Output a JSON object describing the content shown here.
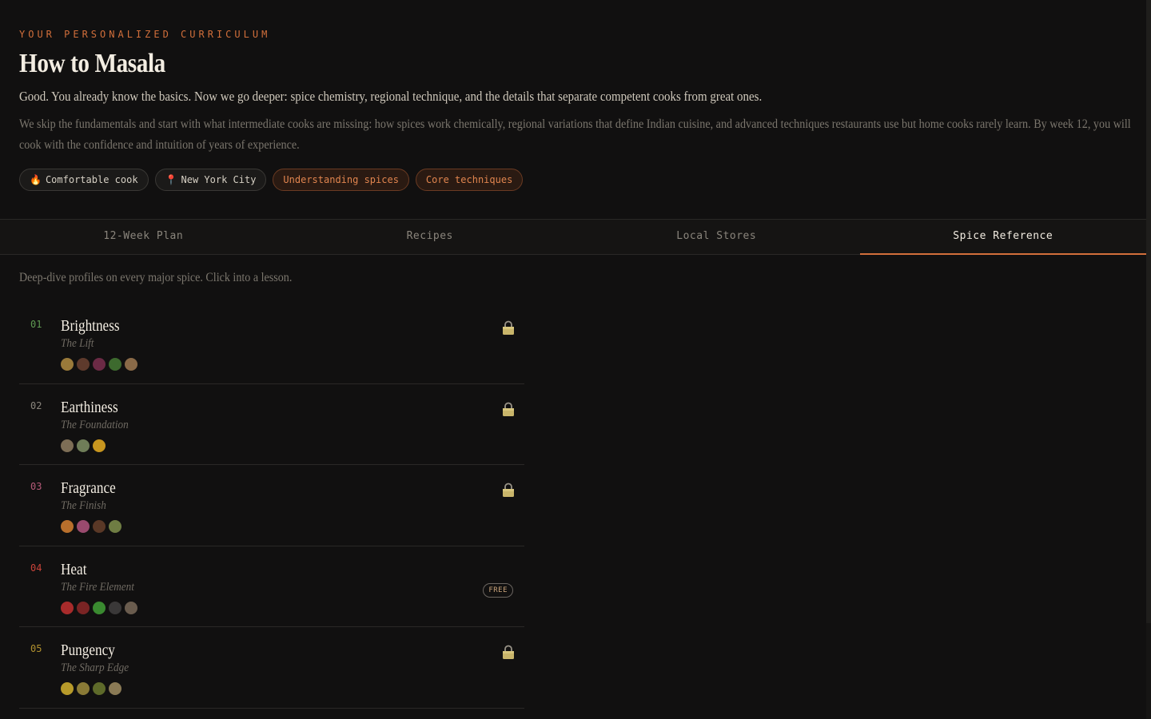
{
  "header": {
    "eyebrow": "YOUR PERSONALIZED CURRICULUM",
    "title": "How to Masala",
    "lede": "Good. You already know the basics. Now we go deeper: spice chemistry, regional technique, and the details that separate competent cooks from great ones.",
    "description": "We skip the fundamentals and start with what intermediate cooks are missing: how spices work chemically, regional variations that define Indian cuisine, and advanced techniques restaurants use but home cooks rarely learn. By week 12, you will cook with the confidence and intuition of years of experience.",
    "chips": [
      {
        "icon": "🔥",
        "icon_name": "fire-icon",
        "label": "Comfortable cook",
        "accent": false
      },
      {
        "icon": "📍",
        "icon_name": "pin-icon",
        "label": "New York City",
        "accent": false
      },
      {
        "icon": "",
        "label": "Understanding spices",
        "accent": true
      },
      {
        "icon": "",
        "label": "Core techniques",
        "accent": true
      }
    ]
  },
  "tabs": [
    {
      "label": "12-Week Plan",
      "active": false
    },
    {
      "label": "Recipes",
      "active": false
    },
    {
      "label": "Local Stores",
      "active": false
    },
    {
      "label": "Spice Reference",
      "active": true
    }
  ],
  "intro": "Deep-dive profiles on every major spice. Click into a lesson.",
  "colors": {
    "accent": "#d26f3b",
    "background": "#111010"
  },
  "lessons": [
    {
      "number": "01",
      "number_color": "#5f9a52",
      "title": "Brightness",
      "subtitle": "The Lift",
      "status": "locked",
      "swatches": [
        "#9a7a3a",
        "#5e3a2c",
        "#6b2a45",
        "#3d6a2e",
        "#8a6a48"
      ]
    },
    {
      "number": "02",
      "number_color": "#8a857c",
      "title": "Earthiness",
      "subtitle": "The Foundation",
      "status": "locked",
      "swatches": [
        "#7d6e56",
        "#6f7d58",
        "#c8961f"
      ]
    },
    {
      "number": "03",
      "number_color": "#b55a78",
      "title": "Fragrance",
      "subtitle": "The Finish",
      "status": "locked",
      "swatches": [
        "#b86f2c",
        "#9a4a6e",
        "#5a3826",
        "#6f7d43"
      ]
    },
    {
      "number": "04",
      "number_color": "#c9433a",
      "title": "Heat",
      "subtitle": "The Fire Element",
      "status": "free",
      "badge": "FREE",
      "swatches": [
        "#a82b2b",
        "#7a2424",
        "#3a8a30",
        "#3a3838",
        "#6a5c4e"
      ]
    },
    {
      "number": "05",
      "number_color": "#b0902e",
      "title": "Pungency",
      "subtitle": "The Sharp Edge",
      "status": "locked",
      "swatches": [
        "#b79a2a",
        "#8a7a36",
        "#5e6a2a",
        "#8a7a55"
      ]
    }
  ]
}
